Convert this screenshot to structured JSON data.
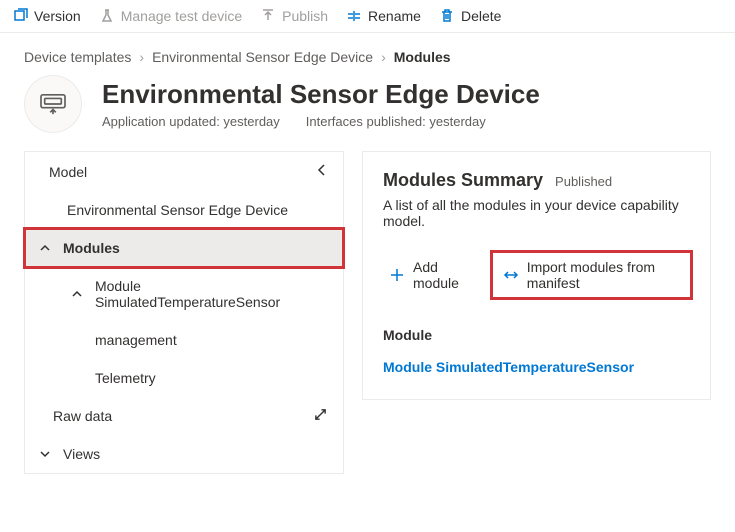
{
  "toolbar": {
    "version": "Version",
    "manage": "Manage test device",
    "publish": "Publish",
    "rename": "Rename",
    "delete": "Delete"
  },
  "breadcrumb": {
    "root": "Device templates",
    "parent": "Environmental Sensor Edge Device",
    "current": "Modules"
  },
  "header": {
    "title": "Environmental Sensor Edge Device",
    "app_updated": "Application updated: yesterday",
    "interfaces_published": "Interfaces published: yesterday"
  },
  "tree": {
    "model": "Model",
    "device": "Environmental Sensor Edge Device",
    "modules": "Modules",
    "module1": "Module SimulatedTemperatureSensor",
    "child1": "management",
    "child2": "Telemetry",
    "rawdata": "Raw data",
    "views": "Views"
  },
  "summary": {
    "title": "Modules Summary",
    "status": "Published",
    "desc": "A list of all the modules in your device capability model.",
    "add": "Add module",
    "import": "Import modules from manifest",
    "module_heading": "Module",
    "module_link": "Module SimulatedTemperatureSensor"
  }
}
